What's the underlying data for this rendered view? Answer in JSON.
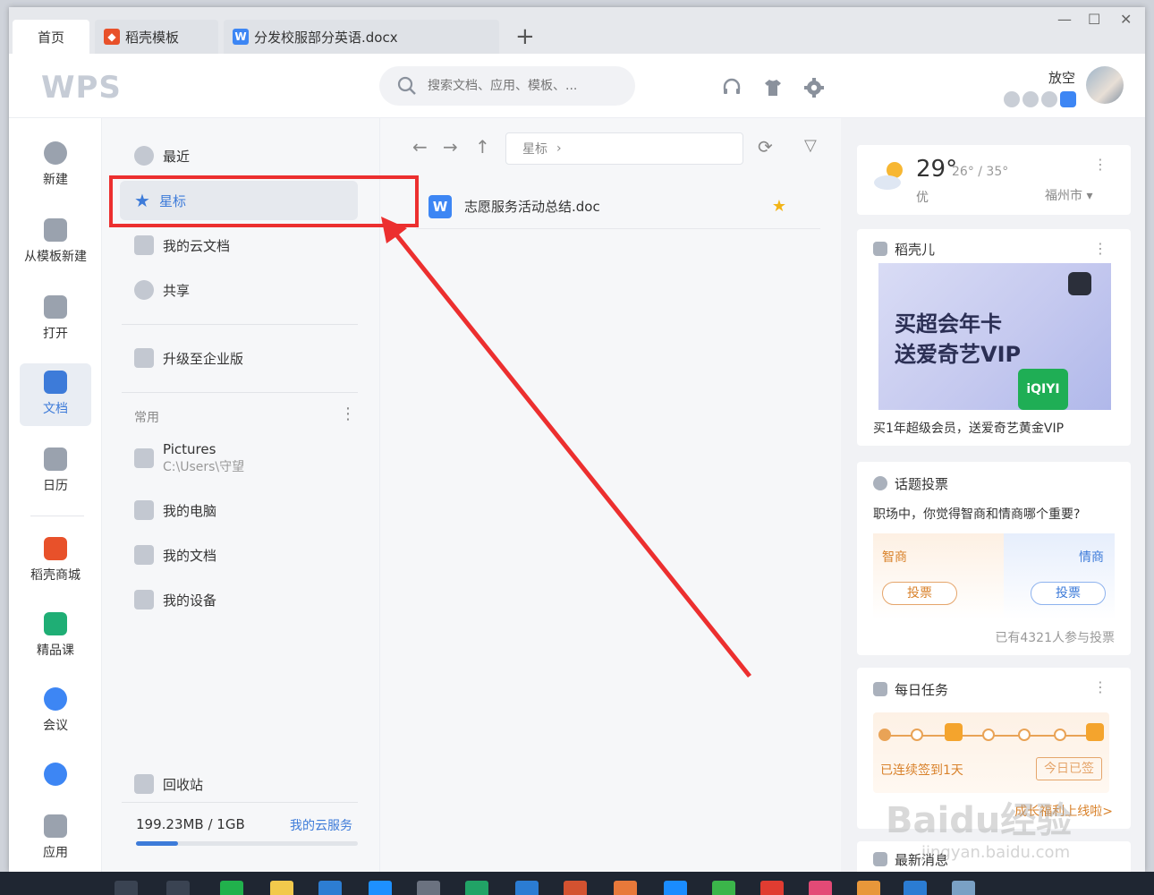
{
  "tabs": [
    {
      "label": "首页"
    },
    {
      "label": "稻壳模板"
    },
    {
      "label": "分发校服部分英语.docx"
    }
  ],
  "header": {
    "logo": "WPS",
    "search_placeholder": "搜索文档、应用、模板、...",
    "username": "放空"
  },
  "leftbar": {
    "items": [
      {
        "label": "新建"
      },
      {
        "label": "从模板新建"
      },
      {
        "label": "打开"
      },
      {
        "label": "文档"
      },
      {
        "label": "日历"
      },
      {
        "label": "稻壳商城"
      },
      {
        "label": "精品课"
      },
      {
        "label": "会议"
      },
      {
        "label": "应用"
      }
    ]
  },
  "nav": {
    "items": [
      {
        "label": "最近"
      },
      {
        "label": "星标"
      },
      {
        "label": "我的云文档"
      },
      {
        "label": "共享"
      },
      {
        "label": "升级至企业版"
      }
    ],
    "frequent_label": "常用",
    "frequent": [
      {
        "label": "Pictures",
        "sub": "C:\\Users\\守望"
      },
      {
        "label": "我的电脑"
      },
      {
        "label": "我的文档"
      },
      {
        "label": "我的设备"
      }
    ],
    "recycle": "回收站",
    "storage": {
      "used": "199.23MB / 1GB",
      "link": "我的云服务",
      "fraction": 0.19
    }
  },
  "files": {
    "path": "星标",
    "rows": [
      {
        "name": "志愿服务活动总结.doc",
        "starred": true
      }
    ]
  },
  "weather": {
    "temp": "29°",
    "range": "26° / 35°",
    "quality": "优",
    "city": "福州市"
  },
  "daoke": {
    "title": "稻壳儿",
    "banner_line1": "买超会年卡",
    "banner_line2": "送爱奇艺VIP",
    "iqiyi": "iQIYI",
    "caption": "买1年超级会员，送爱奇艺黄金VIP"
  },
  "vote": {
    "title": "话题投票",
    "question": "职场中，你觉得智商和情商哪个重要?",
    "option_left": "智商",
    "option_right": "情商",
    "button": "投票",
    "count": "已有4321人参与投票"
  },
  "tasks": {
    "title": "每日任务",
    "streak": "已连续签到1天",
    "signed": "今日已签",
    "growth": "成长福利上线啦>"
  },
  "bottom_card_title": "最新消息",
  "watermark": "Baidu经验",
  "watermark_sub": "jingyan.baidu.com",
  "colors": {
    "accent": "#3d7bd9",
    "annotation": "#ec2f2f",
    "star": "#f2b417"
  }
}
